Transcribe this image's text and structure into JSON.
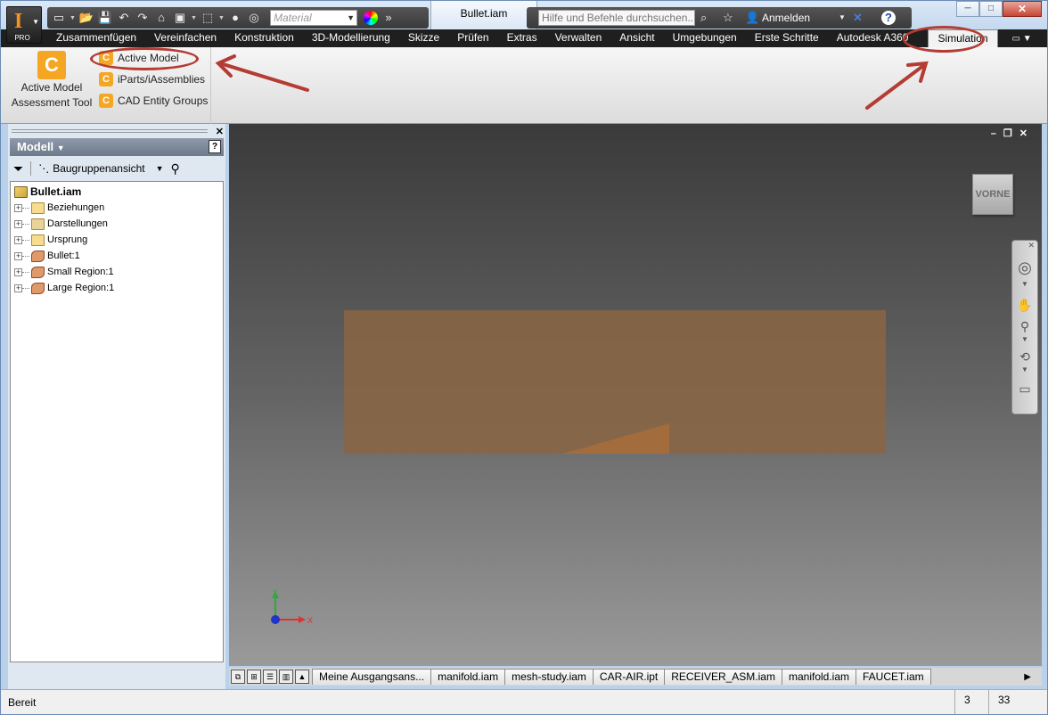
{
  "app": {
    "logo_letter": "I",
    "edition": "PRO"
  },
  "quick_access": {
    "icons": [
      "new-icon",
      "open-icon",
      "save-icon",
      "undo-icon",
      "redo-icon",
      "home-icon",
      "image-icon",
      "select-icon",
      "properties-icon",
      "material-icon",
      "expand-icon"
    ],
    "material_placeholder": "Material"
  },
  "window": {
    "document_title": "Bullet.iam",
    "minimize": "─",
    "maximize": "□",
    "close": "✕"
  },
  "search": {
    "placeholder": "Hilfe und Befehle durchsuchen...",
    "signin_label": "Anmelden"
  },
  "ribbon_tabs": [
    "Zusammenfügen",
    "Vereinfachen",
    "Konstruktion",
    "3D-Modellierung",
    "Skizze",
    "Prüfen",
    "Extras",
    "Verwalten",
    "Ansicht",
    "Umgebungen",
    "Erste Schritte",
    "Autodesk A360",
    "Simulation"
  ],
  "ribbon": {
    "big_button_label_1": "Active Model",
    "big_button_label_2": "Assessment Tool",
    "small_buttons": [
      "Active Model",
      "iParts/iAssemblies",
      "CAD Entity Groups"
    ]
  },
  "browser": {
    "title": "Modell",
    "view_select": "Baugruppenansicht",
    "root": "Bullet.iam",
    "items": [
      {
        "label": "Beziehungen",
        "icon": "folder"
      },
      {
        "label": "Darstellungen",
        "icon": "representations"
      },
      {
        "label": "Ursprung",
        "icon": "folder"
      },
      {
        "label": "Bullet:1",
        "icon": "part"
      },
      {
        "label": "Small Region:1",
        "icon": "part"
      },
      {
        "label": "Large Region:1",
        "icon": "part"
      }
    ]
  },
  "viewport": {
    "viewcube_label": "VORNE",
    "axis_x": "X",
    "axis_y": "Y",
    "colors": {
      "model_face": "#8a6542",
      "axis_x": "#e03030",
      "axis_y": "#2eaa3a",
      "axis_origin": "#2233cc"
    }
  },
  "doc_tabs": [
    "Meine Ausgangsans...",
    "manifold.iam",
    "mesh-study.iam",
    "CAR-AIR.ipt",
    "RECEIVER_ASM.iam",
    "manifold.iam",
    "FAUCET.iam"
  ],
  "status": {
    "text": "Bereit",
    "count_a": "3",
    "count_b": "33"
  },
  "annotations": {
    "highlight_color": "#b43c32"
  }
}
